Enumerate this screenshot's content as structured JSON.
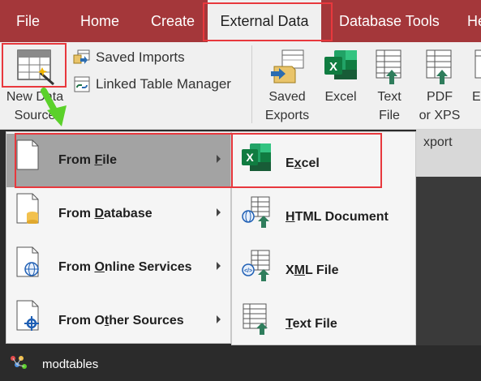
{
  "ribbon_tabs": [
    {
      "label": "File"
    },
    {
      "label": "Home"
    },
    {
      "label": "Create"
    },
    {
      "label": "External Data"
    },
    {
      "label": "Database Tools"
    },
    {
      "label": "He"
    }
  ],
  "import_group": {
    "new_data_source": {
      "line1": "New Data",
      "line2": "Source"
    },
    "saved_imports": "Saved Imports",
    "linked_table_manager": "Linked Table Manager"
  },
  "export_group": {
    "saved_exports": {
      "line1": "Saved",
      "line2": "Exports"
    },
    "excel": "Excel",
    "text_file": {
      "line1": "Text",
      "line2": "File"
    },
    "pdf_xps": {
      "line1": "PDF",
      "line2": "or XPS"
    },
    "email": "E",
    "group_label": "xport"
  },
  "data_source_menu": {
    "items": [
      {
        "pre": "From ",
        "accel": "F",
        "post": "ile"
      },
      {
        "pre": "From ",
        "accel": "D",
        "post": "atabase"
      },
      {
        "pre": "From ",
        "accel": "O",
        "post": "nline Services"
      },
      {
        "pre": "From O",
        "accel": "t",
        "post": "her Sources"
      }
    ]
  },
  "file_submenu": {
    "items": [
      {
        "pre": "E",
        "accel": "x",
        "post": "cel"
      },
      {
        "pre": "",
        "accel": "H",
        "post": "TML Document"
      },
      {
        "pre": "X",
        "accel": "M",
        "post": "L File"
      },
      {
        "pre": "",
        "accel": "T",
        "post": "ext File"
      }
    ]
  },
  "navigation": {
    "object_name": "modtables"
  },
  "colors": {
    "ribbon_tab_bar": "#a4373a",
    "highlight_box": "#e8383d",
    "green_arrow": "#5bd12a",
    "excel_green": "#1e7145"
  }
}
